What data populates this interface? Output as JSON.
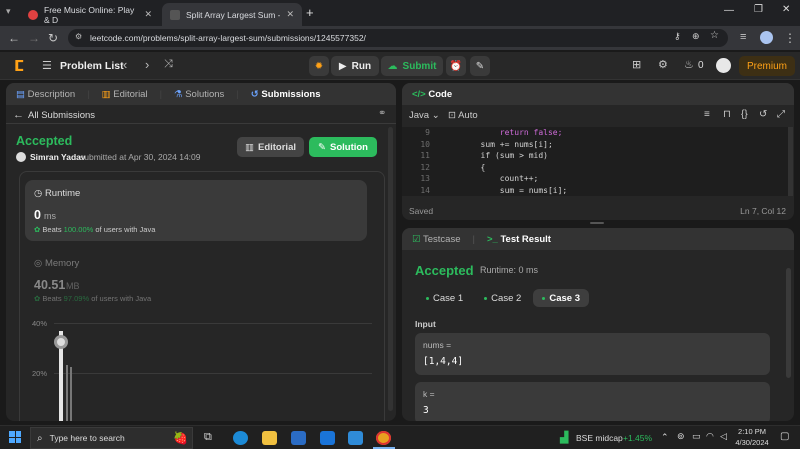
{
  "browser": {
    "tabs": [
      {
        "title": "Free Music Online: Play & D",
        "active": false
      },
      {
        "title": "Split Array Largest Sum - LeetC",
        "active": true
      }
    ],
    "url": "leetcode.com/problems/split-array-largest-sum/submissions/1245577352/"
  },
  "nav": {
    "problem_list": "Problem List",
    "run": "Run",
    "submit": "Submit",
    "streak": "0",
    "premium": "Premium"
  },
  "left": {
    "tabs": [
      "Description",
      "Editorial",
      "Solutions",
      "Submissions"
    ],
    "all_submissions": "All Submissions",
    "status": "Accepted",
    "user": "Simran Yadav",
    "submitted_at": "submitted at Apr 30, 2024 14:09",
    "editorial_btn": "Editorial",
    "solution_btn": "Solution",
    "runtime": {
      "title": "Runtime",
      "value": "0",
      "unit": "ms",
      "beats_label": "Beats",
      "beats": "100.00%",
      "beats_suffix": "of users with Java"
    },
    "memory": {
      "title": "Memory",
      "value": "40.51",
      "unit": "MB",
      "beats_label": "Beats",
      "beats": "97.09%",
      "beats_suffix": "of users with Java"
    },
    "chart": {
      "y40": "40%",
      "y20": "20%"
    }
  },
  "code": {
    "title": "Code",
    "language": "Java",
    "format": "Auto",
    "lines": [
      {
        "n": "9",
        "text": "            return false;"
      },
      {
        "n": "10",
        "text": "        sum += nums[i];"
      },
      {
        "n": "11",
        "text": "        if (sum > mid)"
      },
      {
        "n": "12",
        "text": "        {"
      },
      {
        "n": "13",
        "text": "            count++;"
      },
      {
        "n": "14",
        "text": "            sum = nums[i];"
      }
    ],
    "saved": "Saved",
    "cursor": "Ln 7, Col 12"
  },
  "result": {
    "tab_testcase": "Testcase",
    "tab_result": "Test Result",
    "status": "Accepted",
    "runtime": "Runtime: 0 ms",
    "cases": [
      "Case 1",
      "Case 2",
      "Case 3"
    ],
    "input_label": "Input",
    "var1_name": "nums =",
    "var1_value": "[1,4,4]",
    "var2_name": "k =",
    "var2_value": "3"
  },
  "taskbar": {
    "search": "Type here to search",
    "stock_name": "BSE midcap",
    "stock_change": "+1.45%",
    "time": "2:10 PM",
    "date": "4/30/2024"
  },
  "colors": {
    "accent_green": "#2cbb5d",
    "premium": "#ffa116",
    "accepted": "#2cbb5d"
  }
}
